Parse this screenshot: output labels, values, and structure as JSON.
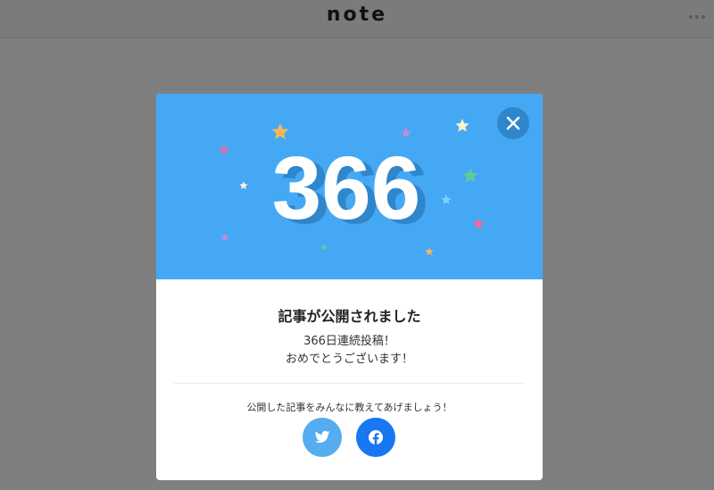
{
  "header": {
    "brand": "note",
    "menu_icon": "more-horizontal-icon"
  },
  "modal": {
    "streak_number": "366",
    "close_icon": "close-icon",
    "title": "記事が公開されました",
    "message_line1": "366日連続投稿！",
    "message_line2": "おめでとうございます！",
    "share_prompt": "公開した記事をみんなに教えてあげましょう！",
    "share_buttons": [
      {
        "name": "twitter",
        "icon": "twitter-icon",
        "color": "#55acee"
      },
      {
        "name": "facebook",
        "icon": "facebook-icon",
        "color": "#1877f2"
      }
    ]
  },
  "colors": {
    "overlay": "#7f7f7f",
    "hero_background": "#45a8f4",
    "close_button": "#2f86cb"
  }
}
